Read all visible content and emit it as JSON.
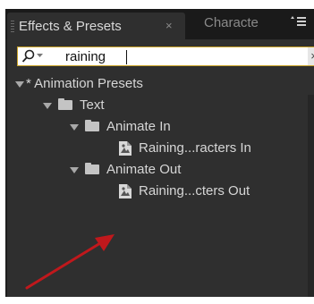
{
  "tabs": {
    "active_label": "Effects & Presets",
    "close_glyph": "×",
    "inactive_label": "Characte",
    "menu_icon": "panel-menu-icon"
  },
  "search": {
    "value": "raining",
    "icon": "search-icon",
    "clear_glyph": "×"
  },
  "tree": {
    "root": "* Animation Presets",
    "text_folder": "Text",
    "animate_in_folder": "Animate In",
    "animate_in_preset": "Raining...racters In",
    "animate_out_folder": "Animate Out",
    "animate_out_preset": "Raining...cters Out"
  },
  "colors": {
    "panel_bg": "#2f2f2f",
    "search_border": "#c9a227",
    "annotation_arrow": "#c0181c"
  }
}
